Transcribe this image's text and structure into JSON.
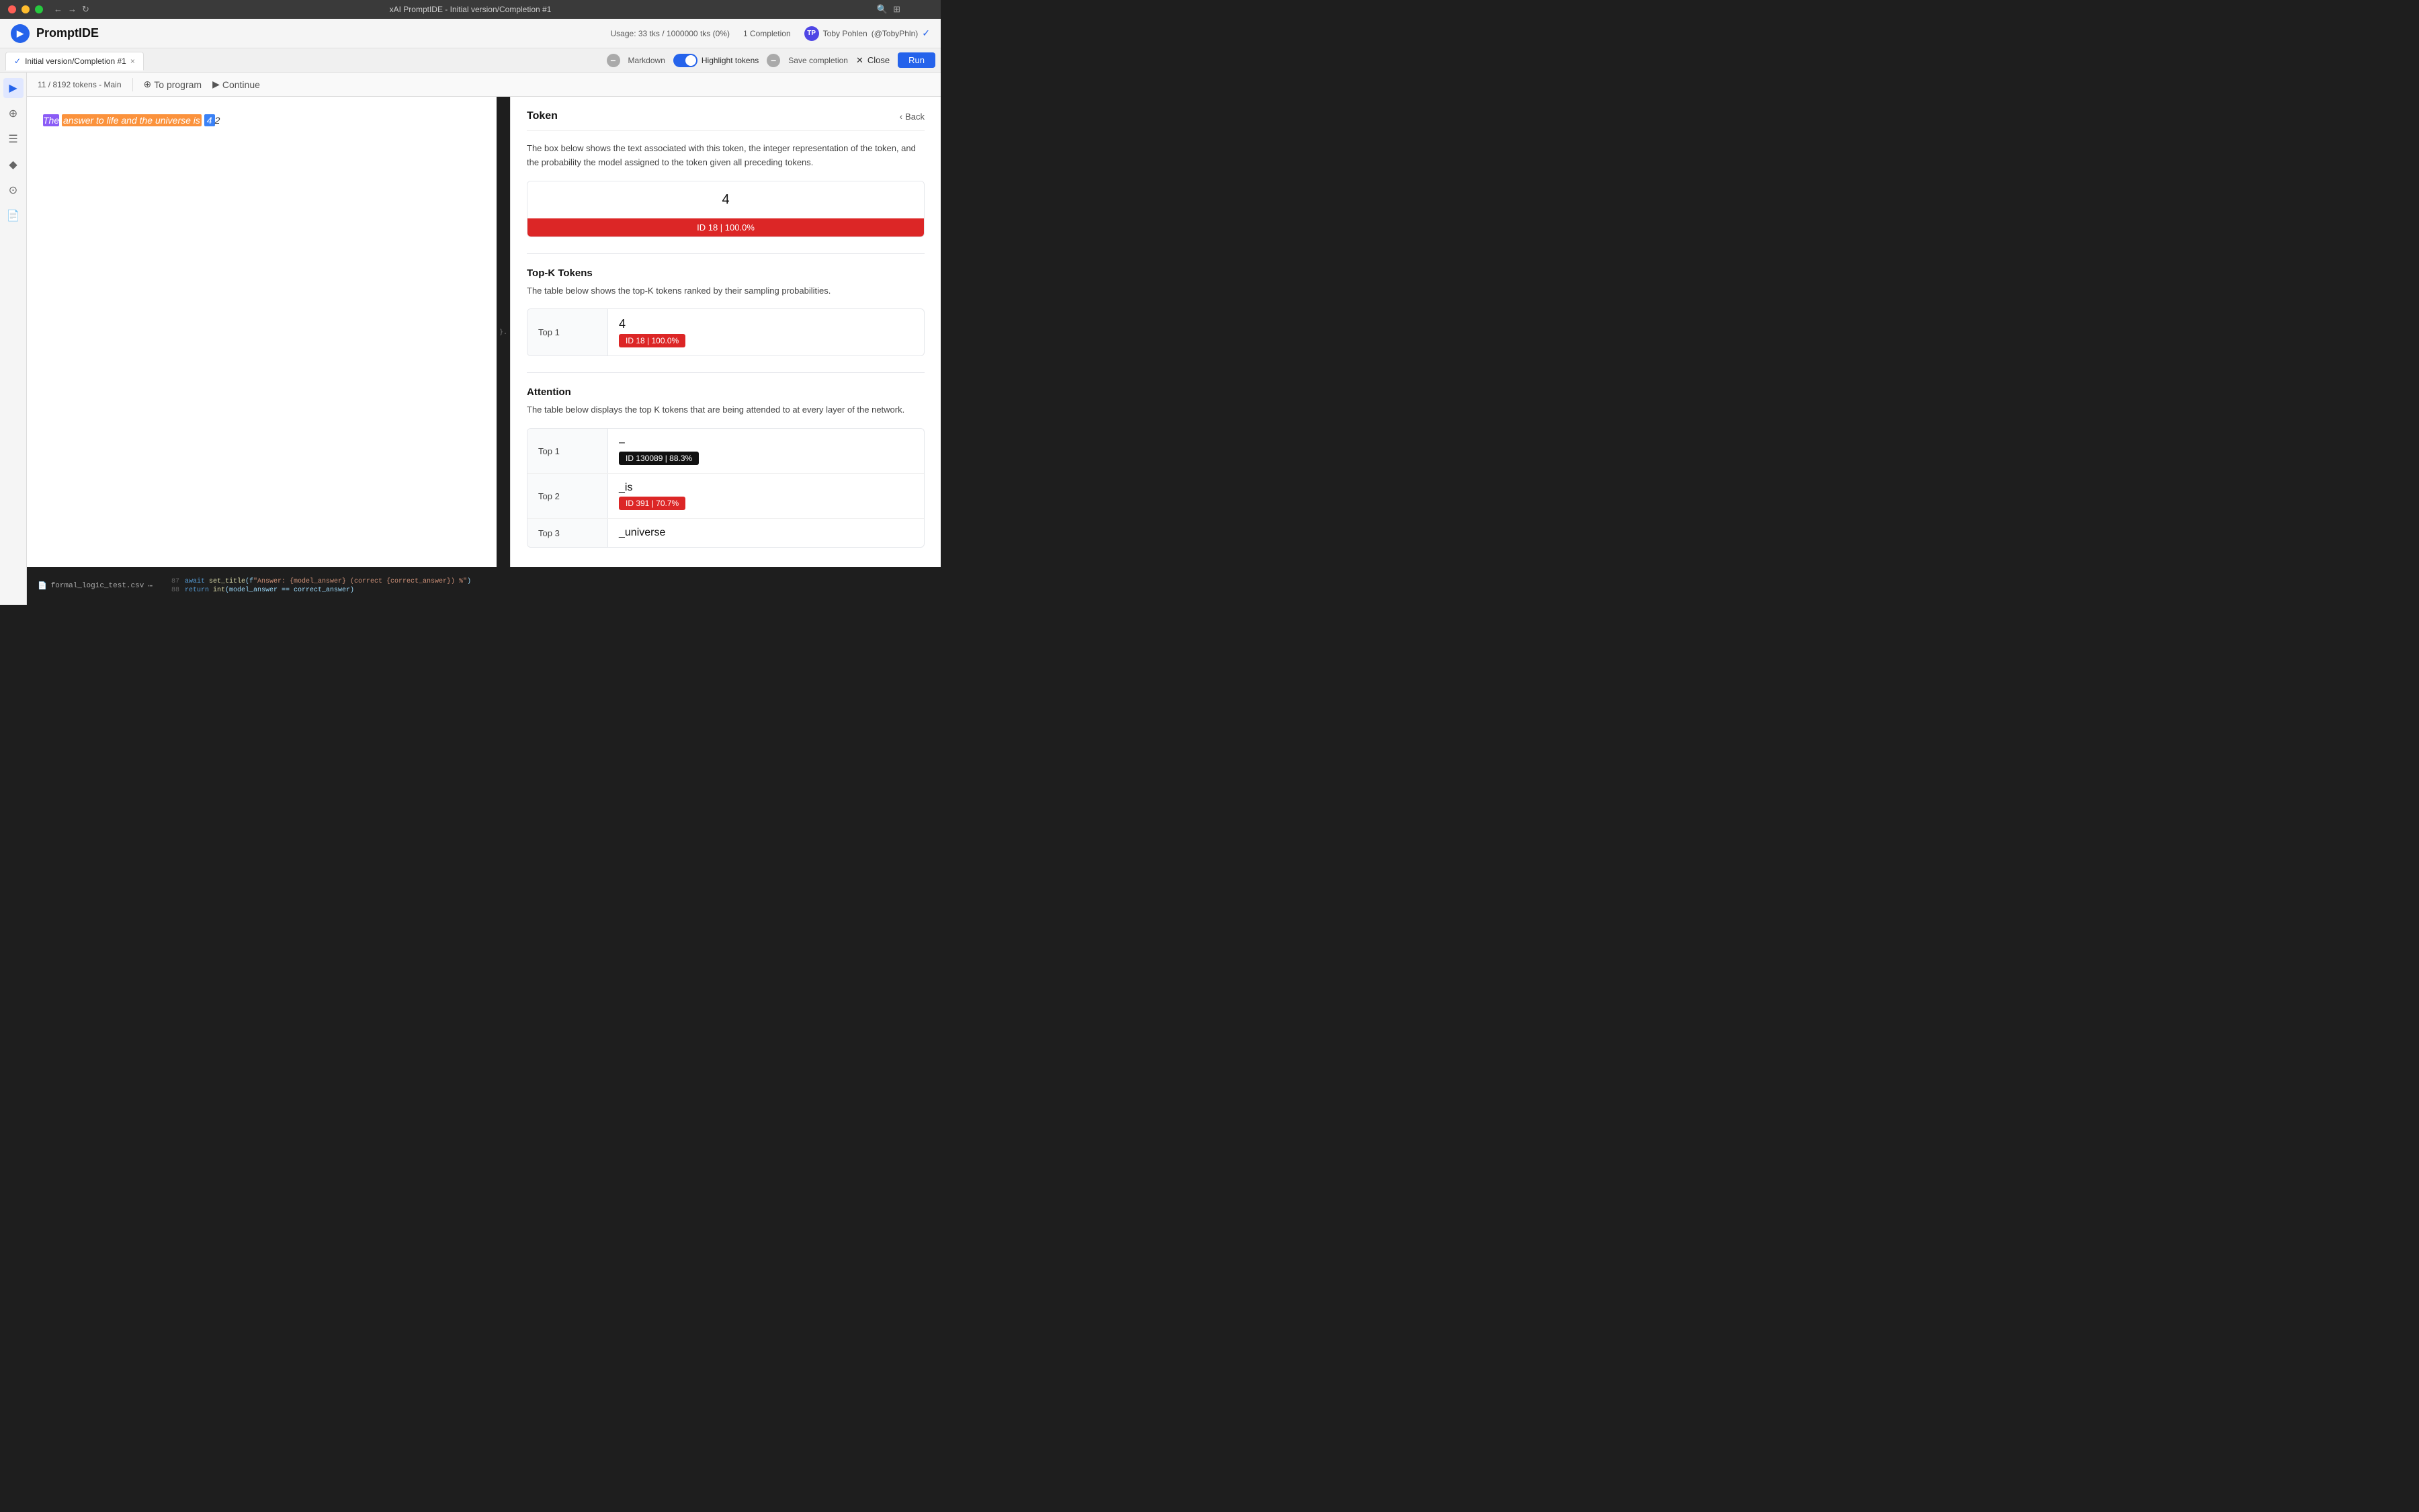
{
  "titlebar": {
    "title": "xAI PromptIDE - Initial version/Completion #1",
    "buttons": {
      "close": "×",
      "min": "−",
      "max": "+"
    }
  },
  "appbar": {
    "logo": "▶",
    "app_name": "PromptIDE",
    "usage": "Usage: 33 tks / 1000000 tks (0%)",
    "completions": "1 Completion",
    "user_name": "Toby Pohlen",
    "user_handle": "(@TobyPhln)"
  },
  "tabbar": {
    "tab_label": "Initial version/Completion #1",
    "markdown": "Markdown",
    "highlight_tokens": "Highlight tokens",
    "save_completion": "Save completion",
    "close": "Close",
    "run": "Run"
  },
  "toolbar": {
    "token_count": "11 / 8192 tokens - Main",
    "to_program": "To program",
    "continue": "Continue"
  },
  "editor": {
    "text_before": "The answer to life and the universe is ",
    "token_42": "4",
    "text_after": "2"
  },
  "token_panel": {
    "title": "Token",
    "back": "Back",
    "description": "The box below shows the text associated with this token, the integer representation of the token, and the probability the model assigned to the token given all preceding tokens.",
    "token_value": "4",
    "token_id_badge": "ID 18 | 100.0%",
    "topk_section": {
      "title": "Top-K Tokens",
      "description": "The table below shows the top-K tokens ranked by their sampling probabilities.",
      "rows": [
        {
          "label": "Top 1",
          "value": "4",
          "badge": "ID 18 | 100.0%"
        }
      ]
    },
    "attention_section": {
      "title": "Attention",
      "description": "The table below displays the top K tokens that are being attended to at every layer of the network.",
      "rows": [
        {
          "label": "Top 1",
          "value": "–",
          "badge": "ID 130089 | 88.3%",
          "badge_type": "dark"
        },
        {
          "label": "Top 2",
          "value": "_is",
          "badge": "ID 391 | 70.7%",
          "badge_type": "red"
        },
        {
          "label": "Top 3",
          "value": "_universe",
          "badge": "",
          "badge_type": "none"
        }
      ]
    }
  },
  "code_bar": {
    "filename": "formal_logic_test.csv",
    "lines": [
      {
        "num": "87",
        "code": "await set_title(f\"Answer: {model_answer} (correct {correct_answer}) %\")"
      },
      {
        "num": "88",
        "code": "return int(model_answer == correct_answer)"
      }
    ]
  },
  "sidebar_icons": [
    "▶",
    "⊕",
    "☰",
    "♦",
    "⊙",
    "📄"
  ]
}
